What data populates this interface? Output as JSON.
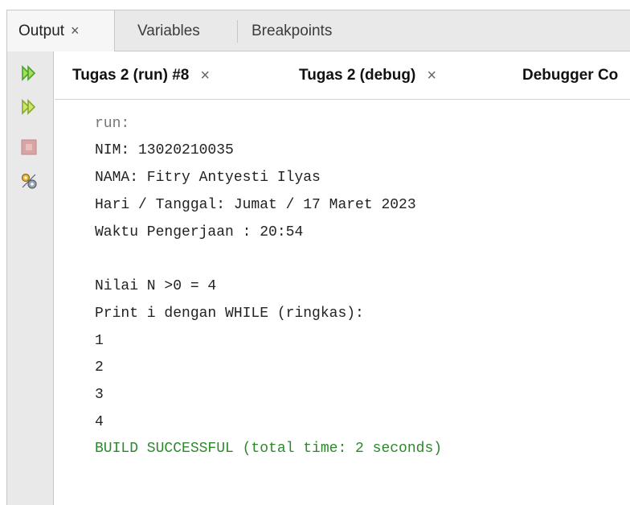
{
  "top_tabs": [
    {
      "label": "Output",
      "close": "×",
      "active": true
    },
    {
      "label": "Variables"
    },
    {
      "label": "Breakpoints"
    }
  ],
  "sub_tabs": [
    {
      "label": "Tugas 2 (run) #8",
      "close": "×"
    },
    {
      "label": "Tugas 2 (debug)",
      "close": "×"
    },
    {
      "label": "Debugger Co"
    }
  ],
  "toolbar": {
    "buttons": [
      {
        "icon": "rerun-icon"
      },
      {
        "icon": "rerun-with-params-icon"
      },
      {
        "icon": "stop-icon"
      },
      {
        "icon": "settings-icon"
      }
    ]
  },
  "console": {
    "header": "run:",
    "lines": [
      "NIM: 13020210035",
      "NAMA: Fitry Antyesti Ilyas",
      "Hari / Tanggal: Jumat / 17 Maret 2023",
      "Waktu Pengerjaan : 20:54",
      "",
      "Nilai N >0 = 4",
      "Print i dengan WHILE (ringkas):",
      "1",
      "2",
      "3",
      "4"
    ],
    "build_status": "BUILD SUCCESSFUL (total time: 2 seconds)"
  },
  "colors": {
    "success": "#2a8a2a",
    "muted": "#777777",
    "rerun_green": "#4aa32a"
  }
}
